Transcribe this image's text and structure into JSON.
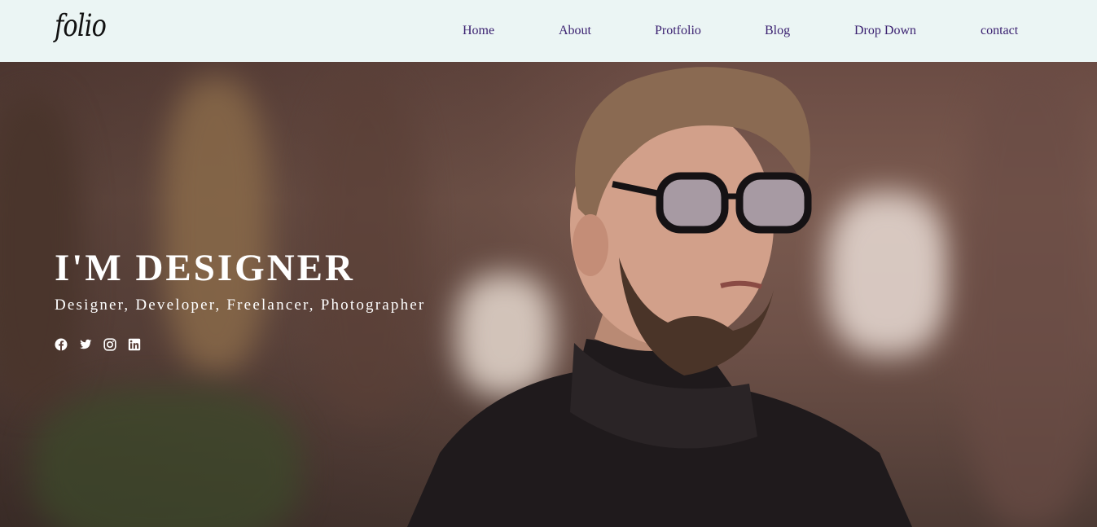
{
  "brand": {
    "logo": "folio"
  },
  "nav": {
    "items": [
      "Home",
      "About",
      "Protfolio",
      "Blog",
      "Drop Down",
      "contact"
    ]
  },
  "hero": {
    "title": "I'M DESIGNER",
    "subtitle": "Designer, Developer, Freelancer, Photographer",
    "socials": [
      "facebook-icon",
      "twitter-icon",
      "instagram-icon",
      "linkedin-icon"
    ]
  },
  "colors": {
    "nav_bg": "#ebf5f4",
    "nav_link": "#3a2070",
    "hero_text": "#ffffff"
  }
}
